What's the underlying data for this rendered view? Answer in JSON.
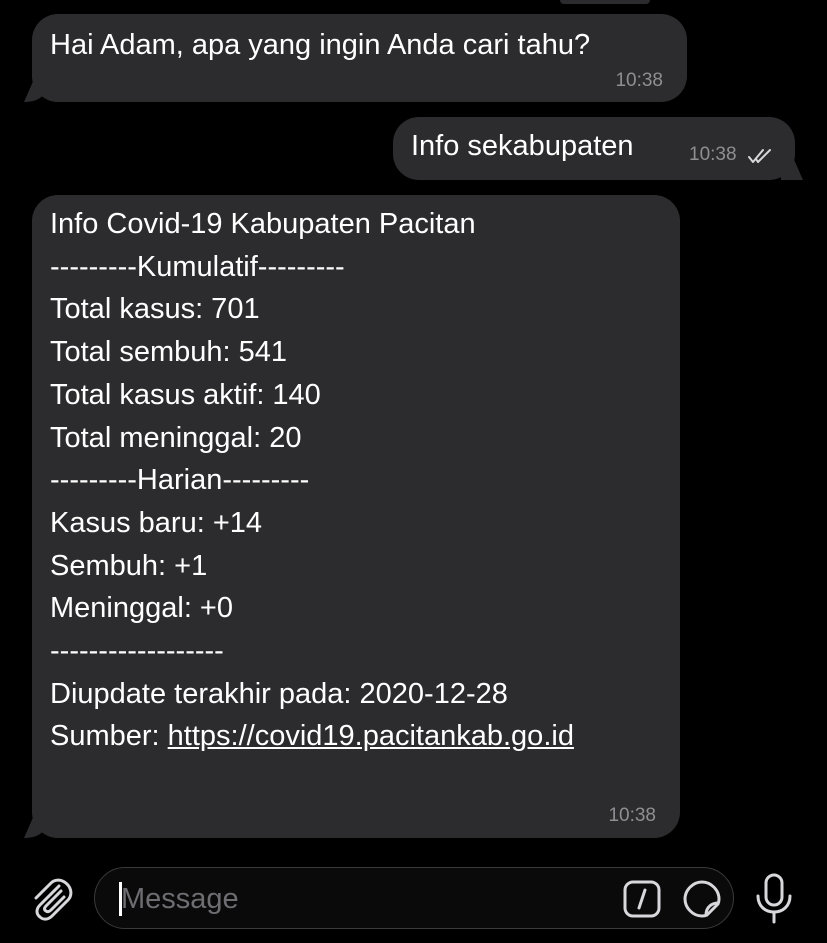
{
  "messages": [
    {
      "direction": "incoming",
      "text": "Hai Adam, apa yang ingin Anda cari tahu?",
      "time": "10:38"
    },
    {
      "direction": "outgoing",
      "text": "Info sekabupaten",
      "time": "10:38",
      "status": "read"
    },
    {
      "direction": "incoming",
      "lines": [
        "Info Covid-19 Kabupaten Pacitan",
        "",
        "---------Kumulatif---------",
        "Total kasus: 701",
        "Total sembuh: 541",
        "Total kasus aktif: 140",
        "Total meninggal: 20",
        "---------Harian---------",
        "Kasus baru: +14",
        "Sembuh: +1",
        "Meninggal: +0",
        "------------------",
        "Diupdate terakhir pada: 2020-12-28"
      ],
      "source_label": "Sumber: ",
      "source_link": "https://covid19.pacitankab.go.id",
      "time": "10:38"
    }
  ],
  "input": {
    "placeholder": "Message",
    "value": ""
  },
  "icons": {
    "attach": "paperclip-icon",
    "commands": "slash-command-icon",
    "sticker": "sticker-icon",
    "mic": "microphone-icon"
  },
  "colors": {
    "background": "#000000",
    "bubble": "#2c2c2e",
    "timestamp": "#8e8e93",
    "placeholder": "#6d6d72",
    "icon": "#d8d8dc"
  }
}
